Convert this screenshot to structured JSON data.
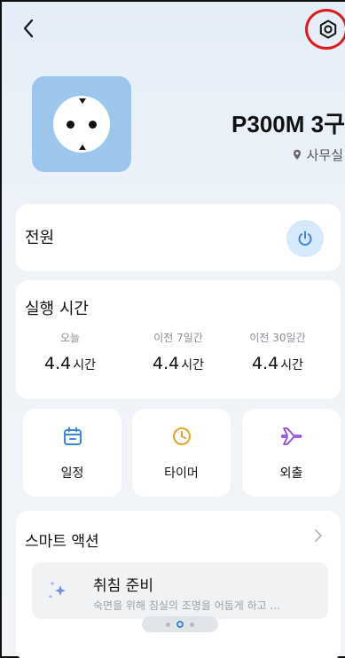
{
  "device": {
    "name": "P300M 3구",
    "location": "사무실"
  },
  "power": {
    "label": "전원",
    "accent": "#3f86d8"
  },
  "runtime": {
    "title": "실행 시간",
    "stats": [
      {
        "label": "오늘",
        "value": "4.4",
        "unit": "시간"
      },
      {
        "label": "이전 7일간",
        "value": "4.4",
        "unit": "시간"
      },
      {
        "label": "이전 30일간",
        "value": "4.4",
        "unit": "시간"
      }
    ]
  },
  "actions": [
    {
      "label": "일정",
      "icon": "calendar-icon"
    },
    {
      "label": "타이머",
      "icon": "clock-icon"
    },
    {
      "label": "외출",
      "icon": "airplane-icon"
    }
  ],
  "smart": {
    "title": "스마트 액션",
    "scene": {
      "name": "취침 준비",
      "description": "숙면을 위해 침실의 조명을 어둡게 하고 ...",
      "icon": "sparkle-icon"
    }
  },
  "pager": {
    "count": 3,
    "active": 2
  }
}
